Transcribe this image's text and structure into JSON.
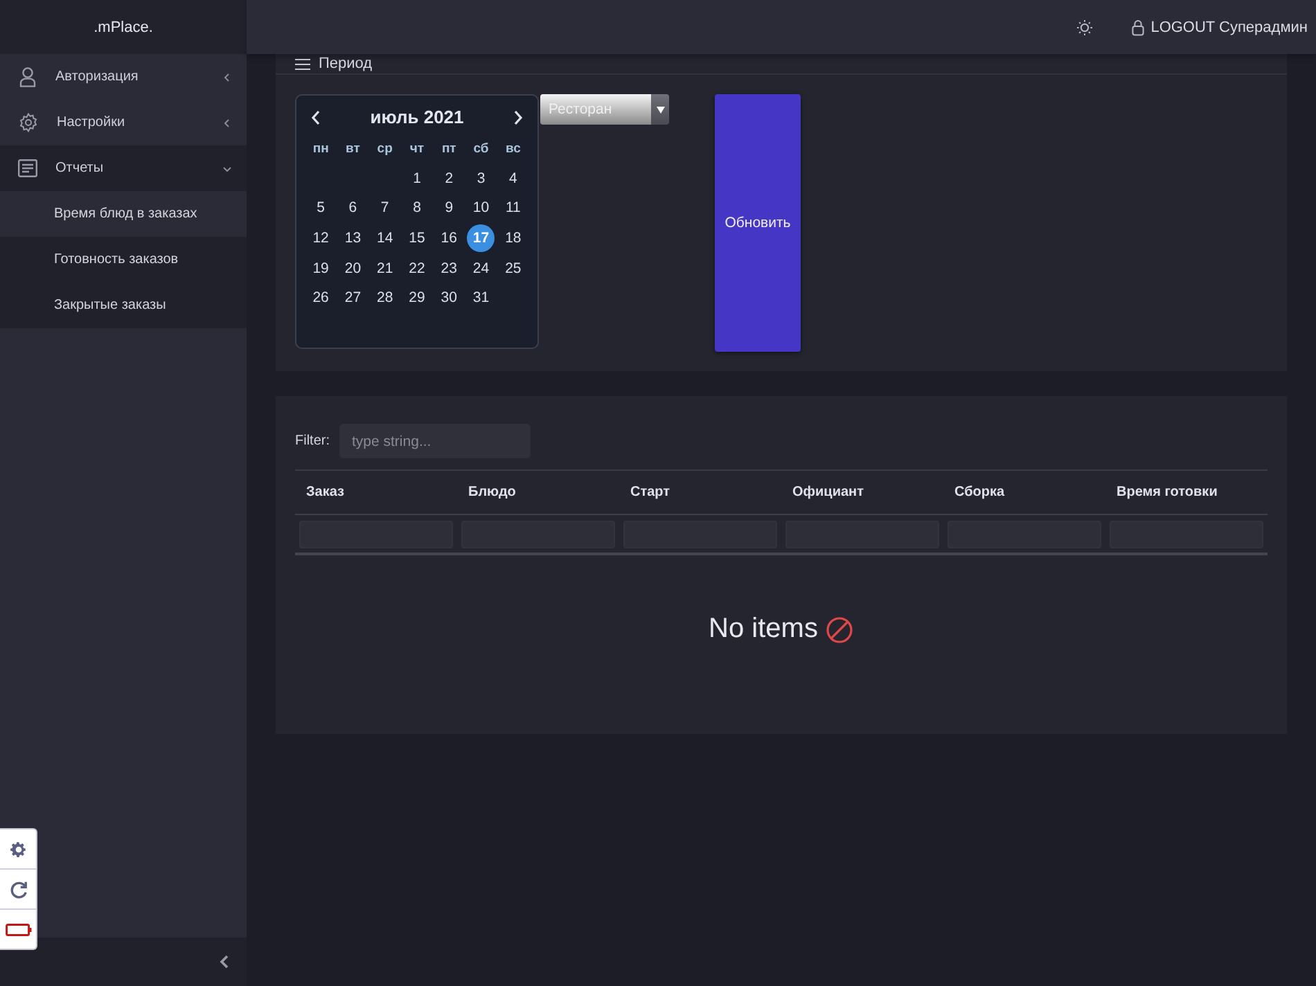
{
  "sidebar": {
    "logo": ".mPlace.",
    "items": [
      {
        "label": "Авторизация",
        "expanded": false
      },
      {
        "label": "Настройки",
        "expanded": false
      },
      {
        "label": "Отчеты",
        "expanded": true,
        "children": [
          {
            "label": "Время блюд в заказах",
            "selected": true
          },
          {
            "label": "Готовность заказов",
            "selected": false
          },
          {
            "label": "Закрытые заказы",
            "selected": false
          }
        ]
      }
    ]
  },
  "topbar": {
    "logout": "LOGOUT",
    "user": "Суперадмин"
  },
  "period": {
    "title": "Период",
    "calendar": {
      "month": "июль 2021",
      "weekdays": [
        "пн",
        "вт",
        "ср",
        "чт",
        "пт",
        "сб",
        "вс"
      ],
      "weeks": [
        [
          {
            "day": "1",
            "selected": false
          },
          {
            "day": "2",
            "selected": false
          },
          {
            "day": "3",
            "selected": false
          },
          {
            "day": "4",
            "selected": false
          }
        ],
        [
          {
            "day": "5",
            "selected": false
          },
          {
            "day": "6",
            "selected": false
          },
          {
            "day": "7",
            "selected": false
          },
          {
            "day": "8",
            "selected": false
          },
          {
            "day": "9",
            "selected": false
          },
          {
            "day": "10",
            "selected": false
          },
          {
            "day": "11",
            "selected": false
          }
        ],
        [
          {
            "day": "12",
            "selected": false
          },
          {
            "day": "13",
            "selected": false
          },
          {
            "day": "14",
            "selected": false
          },
          {
            "day": "15",
            "selected": false
          },
          {
            "day": "16",
            "selected": false
          },
          {
            "day": "17",
            "selected": true
          },
          {
            "day": "18",
            "selected": false
          }
        ],
        [
          {
            "day": "19",
            "selected": false
          },
          {
            "day": "20",
            "selected": false
          },
          {
            "day": "21",
            "selected": false
          },
          {
            "day": "22",
            "selected": false
          },
          {
            "day": "23",
            "selected": false
          },
          {
            "day": "24",
            "selected": false
          },
          {
            "day": "25",
            "selected": false
          }
        ],
        [
          {
            "day": "26",
            "selected": false
          },
          {
            "day": "27",
            "selected": false
          },
          {
            "day": "28",
            "selected": false
          },
          {
            "day": "29",
            "selected": false
          },
          {
            "day": "30",
            "selected": false
          },
          {
            "day": "31",
            "selected": false
          }
        ]
      ]
    },
    "select": {
      "value": "Ресторан"
    },
    "button": "Обновить"
  },
  "table": {
    "filter_label": "Filter:",
    "filter": {
      "placeholder": "type string..."
    },
    "columns": [
      "Заказ",
      "Блюдо",
      "Старт",
      "Официант",
      "Сборка",
      "Время готовки"
    ],
    "empty": "No items"
  }
}
